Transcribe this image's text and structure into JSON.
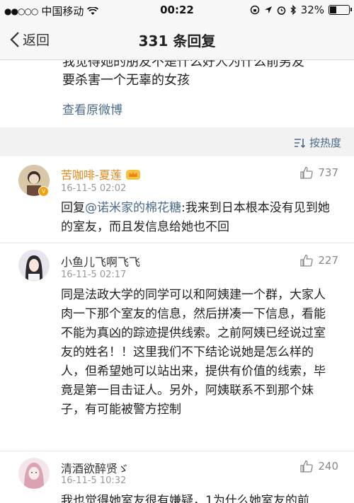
{
  "status_bar": {
    "carrier": "中国移动",
    "time": "00:22",
    "battery": "32%"
  },
  "nav": {
    "back_label": "返回",
    "title": "331 条回复"
  },
  "post": {
    "line1": "我觉得她的朋友不是什么好人为什么前男友",
    "line2": "要杀害一个无辜的女孩",
    "view_original": "查看原微博"
  },
  "sort": {
    "label": "按热度"
  },
  "comments": [
    {
      "name": "苦咖啡-夏莲",
      "time": "16-11-5 02:02",
      "likes": "737",
      "reply_prefix": "回复",
      "mention": "@诺米家的棉花糖",
      "text": ":我来到日本根本没有见到她的室友，而且发信息给她也不回"
    },
    {
      "name": "小鱼儿飞啊飞飞",
      "time": "16-11-5 02:17",
      "likes": "227",
      "text": "同是法政大学的同学可以和阿姨建一个群，大家人肉一下那个室友的信息，然后拼凑一下信息，看能不能为真凶的踪迹提供线索。之前阿姨已经说过室友的姓名！！这里我们不下结论说她是怎么样的人，但希望她可以站出来，提供有价值的线索，毕竟是第一目击证人。另外，阿姨联系不到那个妹子，有可能被警方控制"
    },
    {
      "name": "清酒欲醉贤ゞ",
      "time": "16-11-5 10:32",
      "likes": "240",
      "text": "我也觉得她室友很有嫌疑，1为什么她室友的前"
    }
  ],
  "colors": {
    "link": "#4a6b8a",
    "vip_name": "#e8851a"
  }
}
